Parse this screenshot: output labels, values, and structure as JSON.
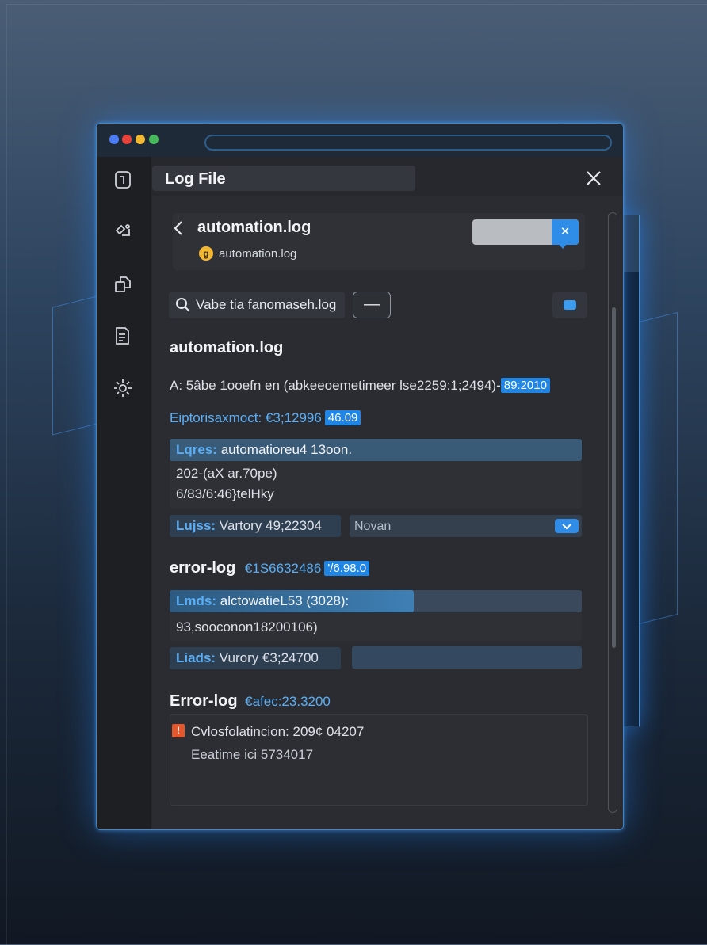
{
  "window": {
    "panel_title": "Log File",
    "traffic_light_colors": [
      "#4a7cf3",
      "#e8433a",
      "#f1b830",
      "#48b85d"
    ]
  },
  "sidebar": {
    "icons": [
      "file-icon",
      "share-icon",
      "copy-icon",
      "document-icon",
      "settings-icon"
    ]
  },
  "file": {
    "name": "automation.log",
    "subtitle": "automation.log",
    "pin_icon": "pin-icon"
  },
  "search": {
    "value": "Vabe tia fanomaseh.log"
  },
  "minus_label": "—",
  "section1": {
    "title": "automation.log",
    "line1": "A: 5âbe 1ooefn en (abkeeoemetimeer lse2259:1;2494)-",
    "line1_badge": "89:2010",
    "line2_text": "Eiptorisaxmoct:",
    "line2_value": "€3;12996",
    "line2_badge": "46.09",
    "bar1_key": "Lqres:",
    "bar1_text": "automatioreu4 13oon.",
    "row2_line1": "202-(aX ar.70pe)",
    "row2_line2": "6/83/6:46}telHky",
    "bar2_key": "Lujss:",
    "bar2_text": "Vartory 49;22304",
    "select_value": "Novan"
  },
  "section2": {
    "title": "error-log",
    "title_value": "€1S6632486",
    "title_badge": "'/6.98.0",
    "bar1_key": "Lmds:",
    "bar1_text": "alctowatieL53 (3028):",
    "row_line": "93,sooconon18200106)",
    "bar2_key": "Liads:",
    "bar2_text": "Vurory €3;24700"
  },
  "section3": {
    "title": "Error-log",
    "title_value": "€afec:23.3200",
    "entry_line1": "Cvlosfolatincion: 209¢ 04207",
    "entry_line2": "Eeatime ici 5734017"
  },
  "colors": {
    "accent": "#1f86e6",
    "link": "#5aaef5",
    "error": "#e2572b",
    "warning": "#f4b731"
  }
}
